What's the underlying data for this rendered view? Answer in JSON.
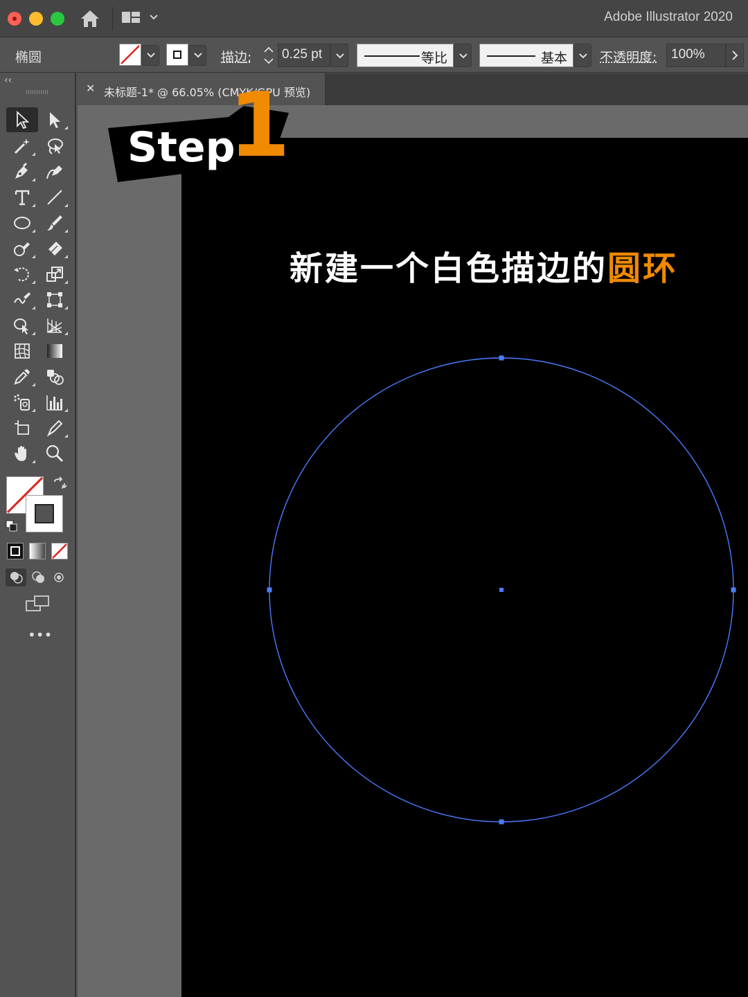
{
  "app": {
    "title": "Adobe Illustrator 2020"
  },
  "control_bar": {
    "object_type": "椭圆",
    "stroke_label": "描边:",
    "stroke_weight": "0.25 pt",
    "stroke_profile": "等比",
    "brush_definition": "基本",
    "opacity_label": "不透明度:",
    "opacity_value": "100%"
  },
  "document": {
    "tab_title": "未标题-1* @ 66.05% (CMYK/GPU 预览)"
  },
  "overlay": {
    "step_word": "Step",
    "step_number": "1",
    "headline_main": "新建一个白色描边的",
    "headline_accent": "圆环"
  },
  "colors": {
    "accent": "#f08a00",
    "selection_blue": "#4a7cff",
    "artboard": "#000000",
    "pasteboard": "#6a6a6a",
    "ui_panel": "#535353"
  },
  "icons": [
    "home-icon",
    "workspace-icon",
    "selection-tool-icon",
    "direct-selection-tool-icon",
    "magic-wand-icon",
    "lasso-icon",
    "pen-tool-icon",
    "curvature-tool-icon",
    "type-tool-icon",
    "line-tool-icon",
    "ellipse-tool-icon",
    "paintbrush-icon",
    "shaper-icon",
    "eraser-icon",
    "rotate-icon",
    "scale-icon",
    "warp-icon",
    "free-transform-icon",
    "shape-builder-icon",
    "perspective-grid-icon",
    "mesh-icon",
    "gradient-icon",
    "eyedropper-icon",
    "blend-icon",
    "symbol-sprayer-icon",
    "column-graph-icon",
    "artboard-tool-icon",
    "slice-icon",
    "hand-icon",
    "zoom-icon"
  ]
}
